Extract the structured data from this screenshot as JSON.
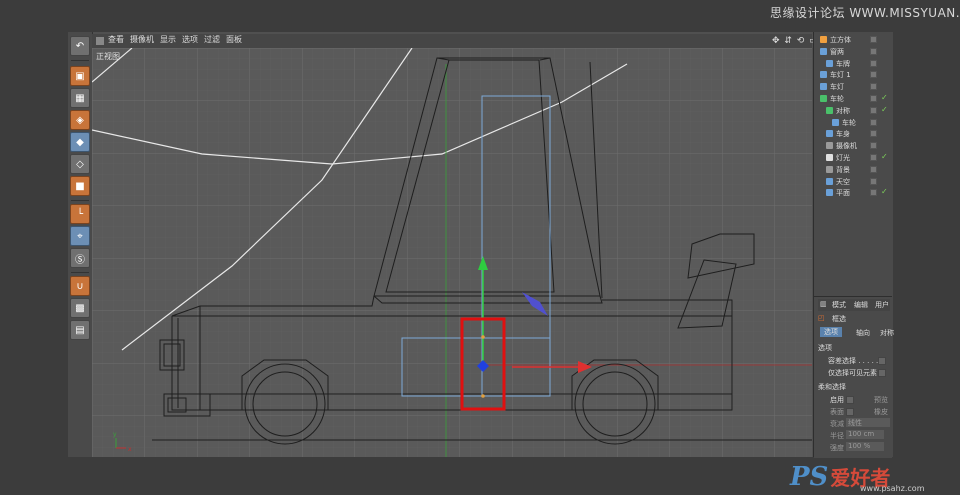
{
  "watermark": {
    "top": "思缘设计论坛 WWW.MISSYUAN.COM",
    "brand": "PS",
    "brand_cn": "爱好者",
    "url": "www.psahz.com"
  },
  "viewport": {
    "menu": [
      "查看",
      "摄像机",
      "显示",
      "选项",
      "过滤",
      "面板"
    ],
    "label": "正视图",
    "nav_icons": "✥ ⇵ ⟲ ▭"
  },
  "objects": [
    {
      "label": "立方体",
      "color": "#f0a040",
      "indent": 0,
      "tick": false
    },
    {
      "label": "窗两",
      "color": "#6aa0d8",
      "indent": 0,
      "tick": false
    },
    {
      "label": "车牌",
      "color": "#6aa0d8",
      "indent": 6,
      "tick": false
    },
    {
      "label": "车灯 1",
      "color": "#6aa0d8",
      "indent": 0,
      "tick": false
    },
    {
      "label": "车灯",
      "color": "#6aa0d8",
      "indent": 0,
      "tick": false
    },
    {
      "label": "车轮",
      "color": "#4ac06a",
      "indent": 0,
      "tick": true
    },
    {
      "label": "对称",
      "color": "#4ac06a",
      "indent": 6,
      "tick": true
    },
    {
      "label": "车轮",
      "color": "#6aa0d8",
      "indent": 12,
      "tick": false
    },
    {
      "label": "车身",
      "color": "#6aa0d8",
      "indent": 6,
      "tick": false
    },
    {
      "label": "摄像机",
      "color": "#9a9a9a",
      "indent": 6,
      "tick": false
    },
    {
      "label": "灯光",
      "color": "#e0e0e0",
      "indent": 6,
      "tick": true
    },
    {
      "label": "背景",
      "color": "#9a9a9a",
      "indent": 6,
      "tick": false
    },
    {
      "label": "天空",
      "color": "#6aa0d8",
      "indent": 6,
      "tick": false
    },
    {
      "label": "平面",
      "color": "#6aa0d8",
      "indent": 6,
      "tick": true
    }
  ],
  "attributes": {
    "menu": [
      "模式",
      "编辑",
      "用户"
    ],
    "tool": "框选",
    "tabs": [
      "选项",
      "轴向",
      "对称"
    ],
    "section_options": "选项",
    "opt_tolerant": "容差选择 . . . . .",
    "opt_visible": "仅选择可见元素",
    "section_soft": "柔和选择",
    "enable": "启用",
    "preview": "预览",
    "surface": "表面",
    "rubber": "橡皮",
    "falloff_label": "衰减",
    "falloff_value": "线性",
    "radius_label": "半径",
    "radius_value": "100 cm",
    "strength_label": "强度",
    "strength_value": "100 %"
  },
  "colors": {
    "selection_box": "#e01010",
    "axis_y": "#2ecc40",
    "axis_x": "#e03030",
    "axis_z": "#4050e0",
    "guide_line": "#e8e8e8"
  }
}
